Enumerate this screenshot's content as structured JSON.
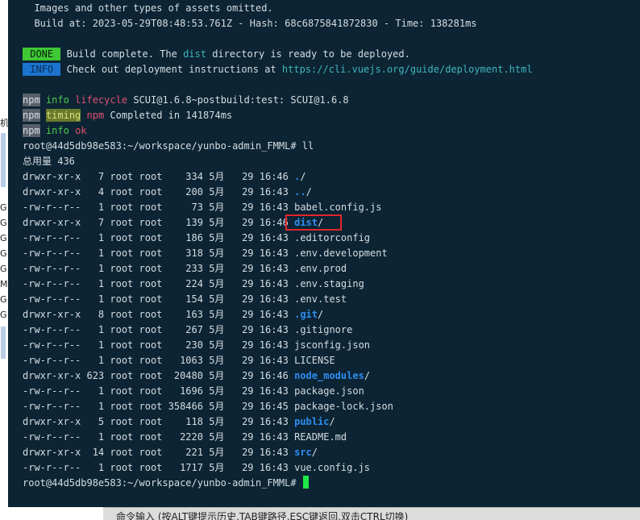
{
  "terminal": {
    "build_info": [
      "Images and other types of assets omitted.",
      "Build at: 2023-05-29T08:48:53.761Z - Hash: 68c6875841872830 - Time: 138281ms"
    ],
    "done_tag": "DONE",
    "done_text": "Build complete. The ",
    "done_dist": "dist",
    "done_tail": " directory is ready to be deployed.",
    "info_tag": "INFO",
    "info_text": "Check out deployment instructions at ",
    "info_url": "https://cli.vuejs.org/guide/deployment.html",
    "npm_lines": [
      {
        "npm": "npm",
        "level": "info",
        "keyword": "lifecycle",
        "text": "SCUI@1.6.8~postbuild:test: SCUI@1.6.8"
      },
      {
        "npm": "npm",
        "level": "timing",
        "keyword": "npm",
        "text": "Completed in 141874ms"
      },
      {
        "npm": "npm",
        "level": "info",
        "keyword": "ok",
        "text": ""
      }
    ],
    "prompt": "root@44d5db98e583:~/workspace/yunbo-admin_FMML#",
    "command": "ll",
    "total_line": "总用量 436",
    "listing": [
      {
        "meta": "drwxr-xr-x   7 root root    334 5月   29 16:46",
        "name": "./",
        "is_dir": true
      },
      {
        "meta": "drwxr-xr-x   4 root root    200 5月   29 16:43",
        "name": "../",
        "is_dir": true
      },
      {
        "meta": "-rw-r--r--   1 root root     73 5月   29 16:43",
        "name": "babel.config.js",
        "is_dir": false
      },
      {
        "meta": "drwxr-xr-x   7 root root    139 5月   29 16:46",
        "name": "dist/",
        "is_dir": true
      },
      {
        "meta": "-rw-r--r--   1 root root    186 5月   29 16:43",
        "name": ".editorconfig",
        "is_dir": false
      },
      {
        "meta": "-rw-r--r--   1 root root    318 5月   29 16:43",
        "name": ".env.development",
        "is_dir": false
      },
      {
        "meta": "-rw-r--r--   1 root root    233 5月   29 16:43",
        "name": ".env.prod",
        "is_dir": false
      },
      {
        "meta": "-rw-r--r--   1 root root    224 5月   29 16:43",
        "name": ".env.staging",
        "is_dir": false
      },
      {
        "meta": "-rw-r--r--   1 root root    154 5月   29 16:43",
        "name": ".env.test",
        "is_dir": false
      },
      {
        "meta": "drwxr-xr-x   8 root root    163 5月   29 16:43",
        "name": ".git/",
        "is_dir": true
      },
      {
        "meta": "-rw-r--r--   1 root root    267 5月   29 16:43",
        "name": ".gitignore",
        "is_dir": false
      },
      {
        "meta": "-rw-r--r--   1 root root    230 5月   29 16:43",
        "name": "jsconfig.json",
        "is_dir": false
      },
      {
        "meta": "-rw-r--r--   1 root root   1063 5月   29 16:43",
        "name": "LICENSE",
        "is_dir": false
      },
      {
        "meta": "drwxr-xr-x 623 root root  20480 5月   29 16:46",
        "name": "node_modules/",
        "is_dir": true
      },
      {
        "meta": "-rw-r--r--   1 root root   1696 5月   29 16:43",
        "name": "package.json",
        "is_dir": false
      },
      {
        "meta": "-rw-r--r--   1 root root 358466 5月   29 16:45",
        "name": "package-lock.json",
        "is_dir": false
      },
      {
        "meta": "drwxr-xr-x   5 root root    118 5月   29 16:43",
        "name": "public/",
        "is_dir": true
      },
      {
        "meta": "-rw-r--r--   1 root root   2220 5月   29 16:43",
        "name": "README.md",
        "is_dir": false
      },
      {
        "meta": "drwxr-xr-x  14 root root    221 5月   29 16:43",
        "name": "src/",
        "is_dir": true
      },
      {
        "meta": "-rw-r--r--   1 root root   1717 5月   29 16:43",
        "name": "vue.config.js",
        "is_dir": false
      }
    ],
    "final_prompt": "root@44d5db98e583:~/workspace/yunbo-admin_FMML#"
  },
  "left_strip": {
    "glyphs": [
      "机",
      "G",
      "G",
      "G",
      "G",
      "G",
      "M",
      "G",
      "G"
    ]
  },
  "command_bar": {
    "hint": "命令输入 (按ALT键提示历史,TAB键路径,ESC键返回,双击CTRL切换)"
  },
  "colors": {
    "terminal_bg": "#0c2433",
    "dir_blue": "#2e8ef0",
    "highlight_red": "#e2262c",
    "cursor_green": "#1ee84a"
  }
}
